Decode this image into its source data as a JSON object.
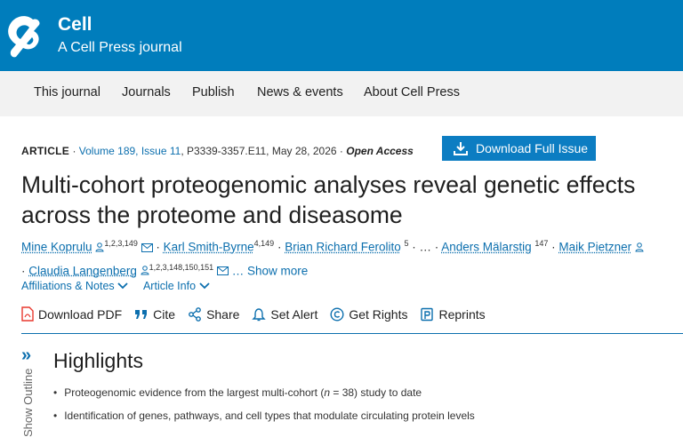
{
  "brand": {
    "title": "Cell",
    "subtitle": "A Cell Press journal"
  },
  "nav": [
    "This journal",
    "Journals",
    "Publish",
    "News & events",
    "About Cell Press"
  ],
  "meta": {
    "type": "ARTICLE",
    "sep": " · ",
    "volume": "Volume 189, Issue 11",
    "pages": ", P3339-3357.E11, May 28, 2026",
    "sep2": " · ",
    "access": "Open Access"
  },
  "download_issue": "Download Full Issue",
  "title_line1": "Multi-cohort proteogenomic analyses reveal genetic effects",
  "title_line2": "across the proteome and diseasome",
  "authors": [
    {
      "name": "Mine Koprulu",
      "sup": "1,2,3,149"
    },
    {
      "name": "Karl Smith-Byrne",
      "sup": "4,149"
    },
    {
      "name": "Brian Richard Ferolito",
      "sup": "5"
    },
    {
      "name": "Anders Mälarstig",
      "sup": "147"
    },
    {
      "name": "Maik Pietzner",
      "sup": ""
    },
    {
      "name": "Claudia Langenberg",
      "sup": "1,2,3,148,150,151"
    }
  ],
  "authors_ellipsis": " · … · ",
  "show_more": "… Show more",
  "info_links": [
    "Affiliations & Notes",
    "Article Info"
  ],
  "actions": [
    "Download PDF",
    "Cite",
    "Share",
    "Set Alert",
    "Get Rights",
    "Reprints"
  ],
  "outline_label": "Show Outline",
  "highlights": {
    "title": "Highlights",
    "items": [
      {
        "pre": "Proteogenomic evidence from the largest multi-cohort (",
        "em": "n",
        "post": " = 38) study to date"
      },
      {
        "pre": "Identification of genes, pathways, and cell types that modulate circulating protein levels",
        "em": "",
        "post": ""
      }
    ]
  },
  "colors": {
    "brand": "#007dbc",
    "link": "#0c6fae",
    "nav_bg": "#f2f2f2",
    "pdf_red": "#e8382f"
  }
}
